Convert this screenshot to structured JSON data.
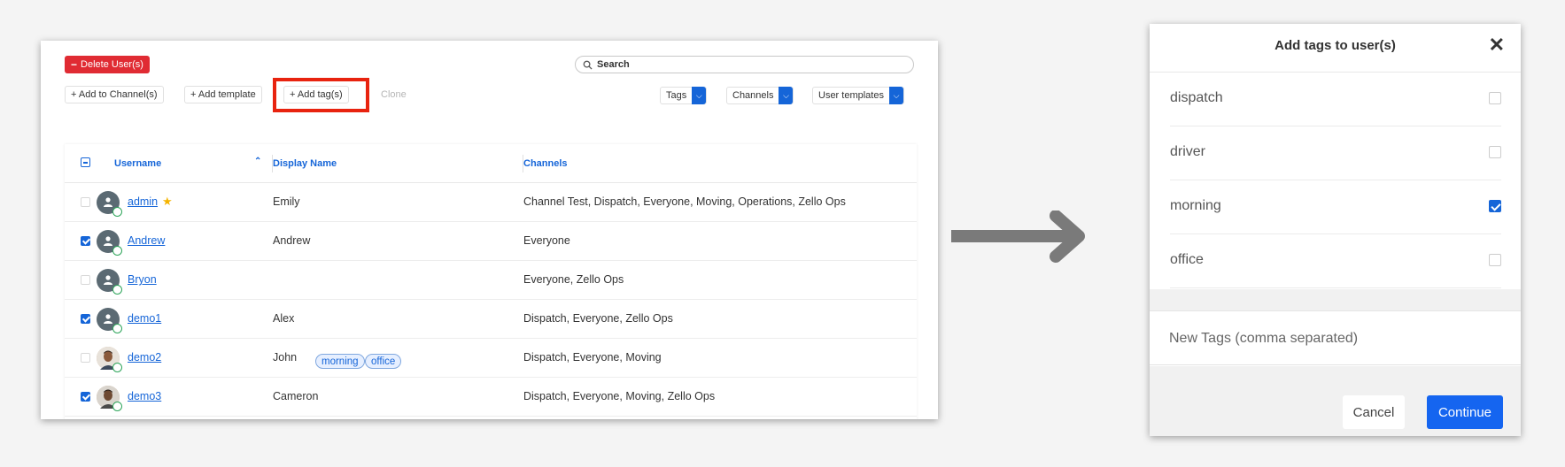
{
  "toolbar": {
    "delete_label": "Delete User(s)",
    "search_placeholder": "Search",
    "add_channels_label": "+ Add to Channel(s)",
    "add_template_label": "+ Add template",
    "add_tags_label": "+ Add tag(s)",
    "clone_label": "Clone",
    "filters": [
      {
        "label": "Tags"
      },
      {
        "label": "Channels"
      },
      {
        "label": "User templates"
      }
    ]
  },
  "table": {
    "headers": {
      "username": "Username",
      "display_name": "Display Name",
      "channels": "Channels"
    },
    "rows": [
      {
        "username": "admin",
        "display_name": "Emily",
        "channels": "Channel Test, Dispatch, Everyone, Moving, Operations, Zello Ops",
        "checked": false,
        "starred": true
      },
      {
        "username": "Andrew",
        "display_name": "Andrew",
        "channels": "Everyone",
        "checked": true
      },
      {
        "username": "Bryon",
        "display_name": "",
        "channels": "Everyone, Zello Ops",
        "checked": false
      },
      {
        "username": "demo1",
        "display_name": "Alex",
        "channels": "Dispatch, Everyone, Zello Ops",
        "checked": true
      },
      {
        "username": "demo2",
        "display_name": "John",
        "channels": "Dispatch, Everyone, Moving",
        "checked": false,
        "tags": [
          "morning",
          "office"
        ]
      },
      {
        "username": "demo3",
        "display_name": "Cameron",
        "channels": "Dispatch, Everyone, Moving, Zello Ops",
        "checked": true
      }
    ]
  },
  "dialog": {
    "title": "Add tags to user(s)",
    "tags": [
      {
        "label": "dispatch",
        "checked": false
      },
      {
        "label": "driver",
        "checked": false
      },
      {
        "label": "morning",
        "checked": true
      },
      {
        "label": "office",
        "checked": false
      }
    ],
    "new_tags_placeholder": "New Tags (comma separated)",
    "cancel_label": "Cancel",
    "continue_label": "Continue"
  },
  "colors": {
    "accent": "#1565d8",
    "danger": "#e02b33",
    "highlight": "#e8230f",
    "arrow": "#7a7a7a"
  }
}
